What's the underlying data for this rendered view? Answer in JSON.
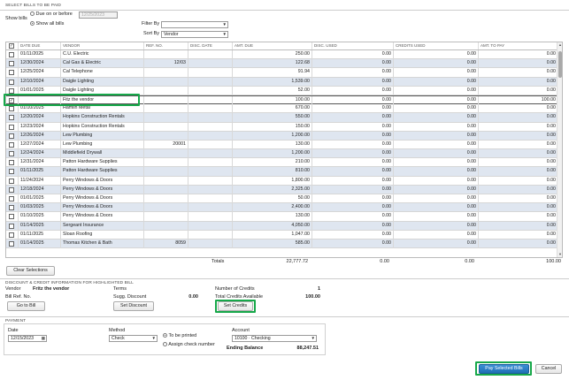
{
  "header": {
    "section_title": "SELECT BILLS TO BE PAID",
    "show_bills_label": "Show bills",
    "due_on_or_before_label": "Due on or before",
    "due_date": "12/25/2023",
    "show_all_label": "Show all bills",
    "filter_by_label": "Filter By",
    "filter_by_value": "",
    "sort_by_label": "Sort By",
    "sort_by_value": "Vendor"
  },
  "table": {
    "columns": [
      "DATE DUE",
      "VENDOR",
      "REF. NO.",
      "DISC. DATE",
      "AMT. DUE",
      "DISC. USED",
      "CREDITS USED",
      "AMT. TO PAY"
    ],
    "rows": [
      {
        "date": "01/11/2025",
        "vendor": "C.U. Electric",
        "ref": "",
        "disc_date": "",
        "amt_due": "250.00",
        "disc_used": "0.00",
        "credits_used": "0.00",
        "amt_to_pay": "0.00",
        "checked": false
      },
      {
        "date": "12/30/2024",
        "vendor": "Cal Gas & Electric",
        "ref": "12/03",
        "disc_date": "",
        "amt_due": "122.68",
        "disc_used": "0.00",
        "credits_used": "0.00",
        "amt_to_pay": "0.00",
        "checked": false
      },
      {
        "date": "12/25/2024",
        "vendor": "Cal Telephone",
        "ref": "",
        "disc_date": "",
        "amt_due": "91.94",
        "disc_used": "0.00",
        "credits_used": "0.00",
        "amt_to_pay": "0.00",
        "checked": false
      },
      {
        "date": "12/10/2024",
        "vendor": "Daigle Lighting",
        "ref": "",
        "disc_date": "",
        "amt_due": "1,539.00",
        "disc_used": "0.00",
        "credits_used": "0.00",
        "amt_to_pay": "0.00",
        "checked": false
      },
      {
        "date": "01/01/2025",
        "vendor": "Daigle Lighting",
        "ref": "",
        "disc_date": "",
        "amt_due": "52.00",
        "disc_used": "0.00",
        "credits_used": "0.00",
        "amt_to_pay": "0.00",
        "checked": false
      },
      {
        "date": "",
        "vendor": "Fitz the vendor",
        "ref": "",
        "disc_date": "",
        "amt_due": "100.00",
        "disc_used": "0.00",
        "credits_used": "0.00",
        "amt_to_pay": "100.00",
        "checked": true
      },
      {
        "date": "01/10/2025",
        "vendor": "Hamlin Metal",
        "ref": "",
        "disc_date": "",
        "amt_due": "670.00",
        "disc_used": "0.00",
        "credits_used": "0.00",
        "amt_to_pay": "0.00",
        "checked": false
      },
      {
        "date": "12/20/2024",
        "vendor": "Hopkins Construction Rentals",
        "ref": "",
        "disc_date": "",
        "amt_due": "550.00",
        "disc_used": "0.00",
        "credits_used": "0.00",
        "amt_to_pay": "0.00",
        "checked": false
      },
      {
        "date": "12/23/2024",
        "vendor": "Hopkins Construction Rentals",
        "ref": "",
        "disc_date": "",
        "amt_due": "150.00",
        "disc_used": "0.00",
        "credits_used": "0.00",
        "amt_to_pay": "0.00",
        "checked": false
      },
      {
        "date": "12/26/2024",
        "vendor": "Lew Plumbing",
        "ref": "",
        "disc_date": "",
        "amt_due": "1,200.00",
        "disc_used": "0.00",
        "credits_used": "0.00",
        "amt_to_pay": "0.00",
        "checked": false
      },
      {
        "date": "12/27/2024",
        "vendor": "Lew Plumbing",
        "ref": "20001",
        "disc_date": "",
        "amt_due": "130.00",
        "disc_used": "0.00",
        "credits_used": "0.00",
        "amt_to_pay": "0.00",
        "checked": false
      },
      {
        "date": "12/24/2024",
        "vendor": "Middlefield Drywall",
        "ref": "",
        "disc_date": "",
        "amt_due": "1,200.00",
        "disc_used": "0.00",
        "credits_used": "0.00",
        "amt_to_pay": "0.00",
        "checked": false
      },
      {
        "date": "12/31/2024",
        "vendor": "Patton Hardware Supplies",
        "ref": "",
        "disc_date": "",
        "amt_due": "210.00",
        "disc_used": "0.00",
        "credits_used": "0.00",
        "amt_to_pay": "0.00",
        "checked": false
      },
      {
        "date": "01/11/2025",
        "vendor": "Patton Hardware Supplies",
        "ref": "",
        "disc_date": "",
        "amt_due": "810.00",
        "disc_used": "0.00",
        "credits_used": "0.00",
        "amt_to_pay": "0.00",
        "checked": false
      },
      {
        "date": "11/24/2024",
        "vendor": "Perry Windows & Doors",
        "ref": "",
        "disc_date": "",
        "amt_due": "1,800.00",
        "disc_used": "0.00",
        "credits_used": "0.00",
        "amt_to_pay": "0.00",
        "checked": false
      },
      {
        "date": "12/18/2024",
        "vendor": "Perry Windows & Doors",
        "ref": "",
        "disc_date": "",
        "amt_due": "2,325.00",
        "disc_used": "0.00",
        "credits_used": "0.00",
        "amt_to_pay": "0.00",
        "checked": false
      },
      {
        "date": "01/01/2025",
        "vendor": "Perry Windows & Doors",
        "ref": "",
        "disc_date": "",
        "amt_due": "50.00",
        "disc_used": "0.00",
        "credits_used": "0.00",
        "amt_to_pay": "0.00",
        "checked": false
      },
      {
        "date": "01/03/2025",
        "vendor": "Perry Windows & Doors",
        "ref": "",
        "disc_date": "",
        "amt_due": "2,400.00",
        "disc_used": "0.00",
        "credits_used": "0.00",
        "amt_to_pay": "0.00",
        "checked": false
      },
      {
        "date": "01/10/2025",
        "vendor": "Perry Windows & Doors",
        "ref": "",
        "disc_date": "",
        "amt_due": "130.00",
        "disc_used": "0.00",
        "credits_used": "0.00",
        "amt_to_pay": "0.00",
        "checked": false
      },
      {
        "date": "01/14/2025",
        "vendor": "Sergeant Insurance",
        "ref": "",
        "disc_date": "",
        "amt_due": "4,050.00",
        "disc_used": "0.00",
        "credits_used": "0.00",
        "amt_to_pay": "0.00",
        "checked": false
      },
      {
        "date": "01/11/2025",
        "vendor": "Sloan Roofing",
        "ref": "",
        "disc_date": "",
        "amt_due": "1,047.00",
        "disc_used": "0.00",
        "credits_used": "0.00",
        "amt_to_pay": "0.00",
        "checked": false
      },
      {
        "date": "01/14/2025",
        "vendor": "Thomas Kitchen & Bath",
        "ref": "8059",
        "disc_date": "",
        "amt_due": "585.00",
        "disc_used": "0.00",
        "credits_used": "0.00",
        "amt_to_pay": "0.00",
        "checked": false
      }
    ],
    "totals": {
      "label": "Totals",
      "amt_due": "22,777.72",
      "disc_used": "0.00",
      "credits_used": "0.00",
      "amt_to_pay": "100.00"
    }
  },
  "clear_selections_label": "Clear Selections",
  "discount": {
    "section_title": "DISCOUNT & CREDIT INFORMATION FOR HIGHLIGHTED BILL",
    "vendor_label": "Vendor",
    "vendor_value": "Fritz the vendor",
    "bill_ref_label": "Bill Ref. No.",
    "terms_label": "Terms",
    "sugg_discount_label": "Sugg. Discount",
    "sugg_discount_value": "0.00",
    "num_credits_label": "Number of Credits",
    "num_credits_value": "1",
    "total_credits_label": "Total Credits Available",
    "total_credits_value": "100.00",
    "go_to_bill_label": "Go to Bill",
    "set_discount_label": "Set Discount",
    "set_credits_label": "Set Credits"
  },
  "payment": {
    "section_title": "PAYMENT",
    "date_label": "Date",
    "date_value": "12/15/2023",
    "method_label": "Method",
    "method_value": "Check",
    "to_be_printed_label": "To be printed",
    "assign_check_label": "Assign check number",
    "account_label": "Account",
    "account_value": "10100 · Checking",
    "ending_balance_label": "Ending Balance",
    "ending_balance_value": "88,247.51"
  },
  "footer": {
    "pay_selected_label": "Pay Selected Bills",
    "cancel_label": "Cancel"
  },
  "colors": {
    "highlight": "#17a84a",
    "alt_row": "#dfe6f0"
  }
}
